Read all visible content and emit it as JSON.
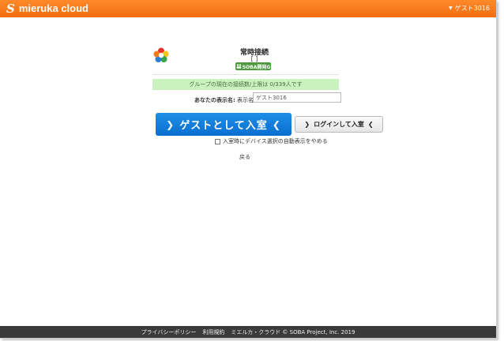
{
  "header": {
    "brand_logo": "S",
    "brand_name": "mieruka cloud",
    "user_name": "ゲスト3016",
    "background_color": "#f47a1f"
  },
  "room": {
    "title": "常時接続",
    "subtitle": "[ ]",
    "badge_label": "SOBA開発G",
    "badge_icon": "people-icon",
    "room_icon": "flower-logo-icon"
  },
  "notice": {
    "text": "グループの現在の接続数/上限は 0/339人です"
  },
  "display_name": {
    "label": "あなたの表示名:",
    "field_label": "表示名",
    "value": "ゲスト3016",
    "placeholder": ""
  },
  "buttons": {
    "guest_enter": "ゲストとして入室",
    "login_enter": "ログインして入室"
  },
  "options": {
    "auto_device_label": "入室時にデバイス選択の自動表示をやめる",
    "auto_device_checked": false
  },
  "links": {
    "back": "戻る"
  },
  "footer": {
    "privacy": "プライバシーポリシー",
    "terms": "利用規約",
    "copyright": "ミエルカ・クラウド © SOBA Project, Inc. 2019"
  }
}
